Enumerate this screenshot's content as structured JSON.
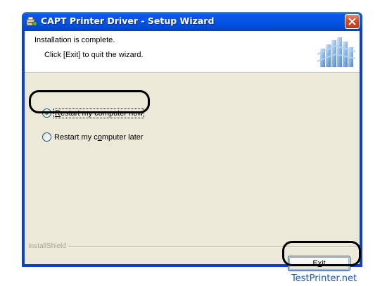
{
  "window": {
    "title": "CAPT Printer Driver - Setup Wizard"
  },
  "header": {
    "title": "Installation is complete.",
    "subtitle": "Click [Exit] to quit the wizard."
  },
  "options": [
    {
      "label_pre": "",
      "label_mnemonic": "R",
      "label_post": "estart my computer now",
      "selected": true
    },
    {
      "label_pre": "Restart my c",
      "label_mnemonic": "o",
      "label_post": "mputer later",
      "selected": false
    }
  ],
  "branding": {
    "text": "InstallShield"
  },
  "buttons": {
    "exit_pre": "E",
    "exit_mnemonic": "x",
    "exit_post": "it"
  },
  "watermark": "TestPrinter.net",
  "colors": {
    "titlebar": "#0455e6",
    "client_bg": "#ece9d8",
    "radio_selected": "#21a121",
    "close_button": "#d6472a"
  }
}
